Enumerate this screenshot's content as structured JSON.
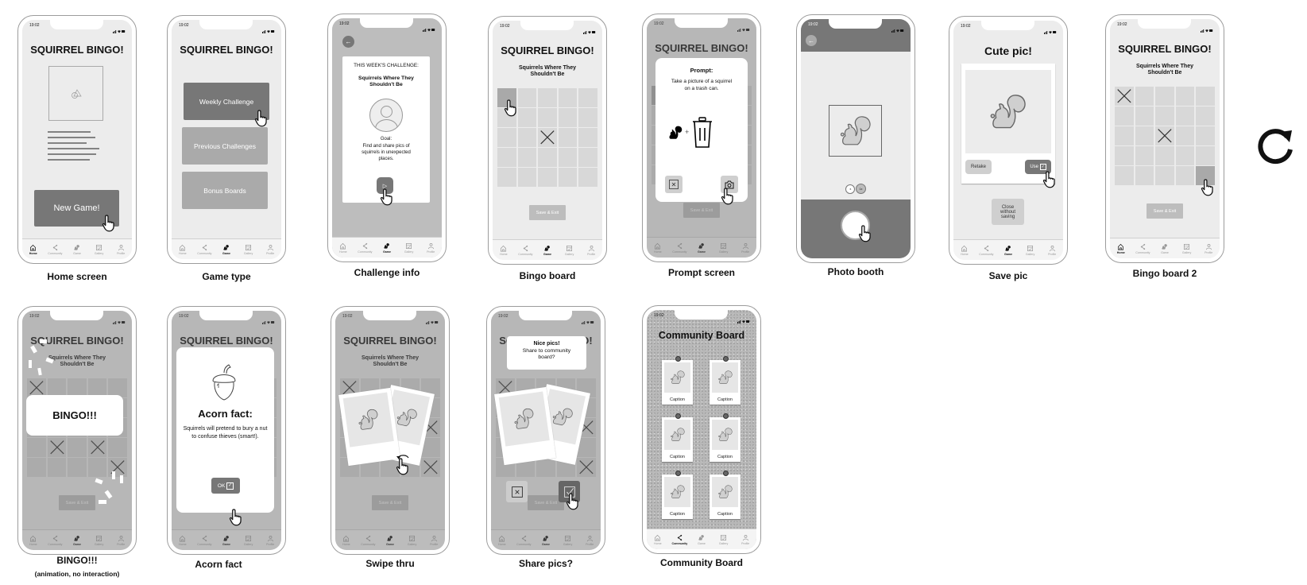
{
  "status_time": "19:02",
  "nav": [
    "Home",
    "Community",
    "Game",
    "Gallery",
    "Profile"
  ],
  "app_title": "SQUIRREL BINGO!",
  "challenge_name": "Squirrels Where They Shouldn't Be",
  "save_exit": "Save & Exit",
  "colors": {
    "dark_button": "#777777",
    "mid_button": "#aaaaaa",
    "cell": "#d8d8d8",
    "screen_bg": "#ececec"
  },
  "screens": {
    "home": {
      "caption": "Home screen",
      "new_game": "New Game!",
      "nav_active": 0
    },
    "game_type": {
      "caption": "Game type",
      "buttons": [
        "Weekly Challenge",
        "Previous Challenges",
        "Bonus Boards"
      ],
      "nav_active": 2
    },
    "challenge": {
      "caption": "Challenge info",
      "heading": "THIS WEEK'S CHALLENGE:",
      "goal_label": "Goal:",
      "goal": "Find and share pics of squirrels in unexpected places.",
      "nav_active": 2
    },
    "board": {
      "caption": "Bingo board",
      "grid": [
        "s....",
        ".....",
        "..x..",
        ".....",
        "....."
      ],
      "nav_active": 2
    },
    "prompt": {
      "caption": "Prompt screen",
      "heading": "Prompt:",
      "text": "Take a picture of a squirrel on a trash can.",
      "plus": "+",
      "grid": [
        "s....",
        ".....",
        "..x..",
        ".....",
        "....."
      ],
      "nav_active": 2
    },
    "booth": {
      "caption": "Photo booth",
      "zoom_options": [
        ".5",
        "1x"
      ]
    },
    "save_pic": {
      "caption": "Save pic",
      "title": "Cute pic!",
      "retake": "Retake",
      "use": "Use",
      "close": "Close without saving",
      "nav_active": 2
    },
    "board2": {
      "caption": "Bingo board 2",
      "grid": [
        "x....",
        ".....",
        "..x..",
        ".....",
        "....s"
      ],
      "nav_active": 0
    },
    "bingo": {
      "caption": "BINGO!!!",
      "caption_note": "(animation, no interaction)",
      "banner": "BINGO!!!",
      "grid": [
        "x....",
        ".....",
        ".....",
        ".x.x.",
        "....x"
      ],
      "nav_active": 2
    },
    "acorn": {
      "caption": "Acorn fact",
      "title": "Acorn fact:",
      "text": "Squirrels will pretend to bury a nut to confuse thieves (smart!).",
      "ok": "OK",
      "grid": [
        "x....",
        ".....",
        ".....",
        ".....",
        "....."
      ],
      "nav_active": 2
    },
    "swipe": {
      "caption": "Swipe thru",
      "grid": [
        "x....",
        ".....",
        "....x",
        ".....",
        "....x"
      ],
      "nav_active": 2
    },
    "share": {
      "caption": "Share pics?",
      "title": "Nice pics!",
      "text": "Share to community board?",
      "grid": [
        "x....",
        ".....",
        "....x",
        ".....",
        "....x"
      ],
      "nav_active": 2
    },
    "community": {
      "caption": "Community Board",
      "title": "Community Board",
      "captions": [
        "Caption",
        "Caption",
        "Caption",
        "Caption",
        "Caption",
        "Caption"
      ],
      "nav_active": 1
    }
  }
}
